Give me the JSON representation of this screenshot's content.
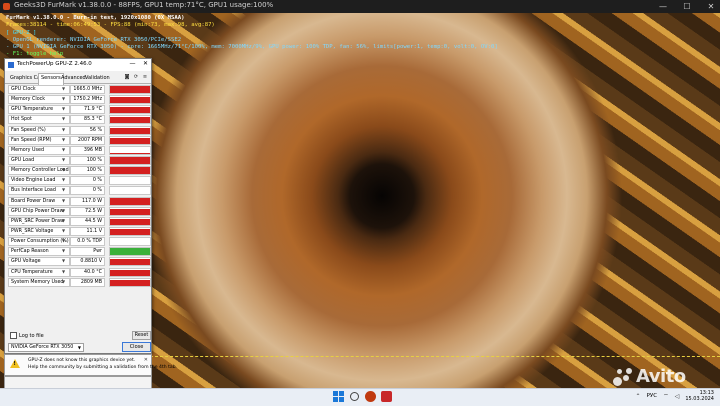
{
  "furmark": {
    "title": "Geeks3D FurMark v1.38.0.0 - 88FPS, GPU1 temp:71°C, GPU1 usage:100%",
    "osd": [
      {
        "text": "FurMark v1.38.0.0 - Burn-in test, 1920x1080 (0X MSAA)",
        "color": "white"
      },
      {
        "text": "Frames:38114 - time:06:49:53 - FPS:88 (min:73, max:98, avg:87)",
        "color": "yellow"
      },
      {
        "text": "[ GPU-Z ]",
        "color": "cyan"
      },
      {
        "text": "- OpenGL renderer: NVIDIA GeForce RTX 3050/PCIe/SSE2",
        "color": "cyan2"
      },
      {
        "text": "- GPU 1 (NVIDIA GeForce RTX 3050) - core: 1665MHz/71°C/100%, mem: 7000MHz/9%, GPU power: 100% TDP, fan: 56%, limits[power:1, temp:0, volt:0, OV:0]",
        "color": "cyan2"
      },
      {
        "text": "- F1: toggle help",
        "color": "green"
      }
    ]
  },
  "gpuz": {
    "title": "TechPowerUp GPU-Z 2.46.0",
    "tabs": [
      "Graphics Card",
      "Sensors",
      "Advanced",
      "Validation"
    ],
    "active_tab": "Sensors",
    "sensors": [
      {
        "label": "GPU Clock",
        "value": "1665.0 MHz",
        "fill": 0.95,
        "color": "#d42020"
      },
      {
        "label": "Memory Clock",
        "value": "1750.2 MHz",
        "fill": 0.95,
        "color": "#d42020"
      },
      {
        "label": "GPU Temperature",
        "value": "71.9 °C",
        "fill": 0.85,
        "color": "#d42020"
      },
      {
        "label": "Hot Spot",
        "value": "85.3 °C",
        "fill": 0.88,
        "color": "#d42020"
      },
      {
        "label": "Fan Speed (%)",
        "value": "56 %",
        "fill": 0.85,
        "color": "#d42020"
      },
      {
        "label": "Fan Speed (RPM)",
        "value": "2007 RPM",
        "fill": 0.85,
        "color": "#d42020"
      },
      {
        "label": "Memory Used",
        "value": "396 MB",
        "fill": 0.15,
        "color": "#d42020"
      },
      {
        "label": "GPU Load",
        "value": "100 %",
        "fill": 1.0,
        "color": "#d42020"
      },
      {
        "label": "Memory Controller Load",
        "value": "100 %",
        "fill": 1.0,
        "color": "#d42020"
      },
      {
        "label": "Video Engine Load",
        "value": "0 %",
        "fill": 0.0,
        "color": "#d42020"
      },
      {
        "label": "Bus Interface Load",
        "value": "0 %",
        "fill": 0.03,
        "color": "#d42020"
      },
      {
        "label": "Board Power Draw",
        "value": "117.0 W",
        "fill": 0.95,
        "color": "#d42020"
      },
      {
        "label": "GPU Chip Power Draw",
        "value": "72.5 W",
        "fill": 0.85,
        "color": "#d42020"
      },
      {
        "label": "PWR_SRC Power Draw",
        "value": "44.5 W",
        "fill": 0.85,
        "color": "#d42020"
      },
      {
        "label": "PWR_SRC Voltage",
        "value": "11.1 V",
        "fill": 0.85,
        "color": "#d42020"
      },
      {
        "label": "Power Consumption (%)",
        "value": "0.0 % TDP",
        "fill": 0.0,
        "color": "#d42020"
      },
      {
        "label": "PerfCap Reason",
        "value": "Pwr",
        "fill": 1.0,
        "color": "#3ab03a"
      },
      {
        "label": "GPU Voltage",
        "value": "0.8810 V",
        "fill": 0.85,
        "color": "#d42020"
      },
      {
        "label": "CPU Temperature",
        "value": "40.0 °C",
        "fill": 0.85,
        "color": "#d42020"
      },
      {
        "label": "System Memory Used",
        "value": "2809 MB",
        "fill": 0.85,
        "color": "#d42020"
      }
    ],
    "log_label": "Log to file",
    "reset_label": "Reset",
    "device_select": "NVIDIA GeForce RTX 3050",
    "close_label": "Close"
  },
  "notification": {
    "line1": "GPU-Z does not know this graphics device yet.",
    "line2": "Help the community by submitting a validation from the 4th tab."
  },
  "taskbar": {
    "language": "РУС",
    "time": "13:13",
    "date": "15.03.2024"
  },
  "watermark": {
    "text": "Avito"
  }
}
